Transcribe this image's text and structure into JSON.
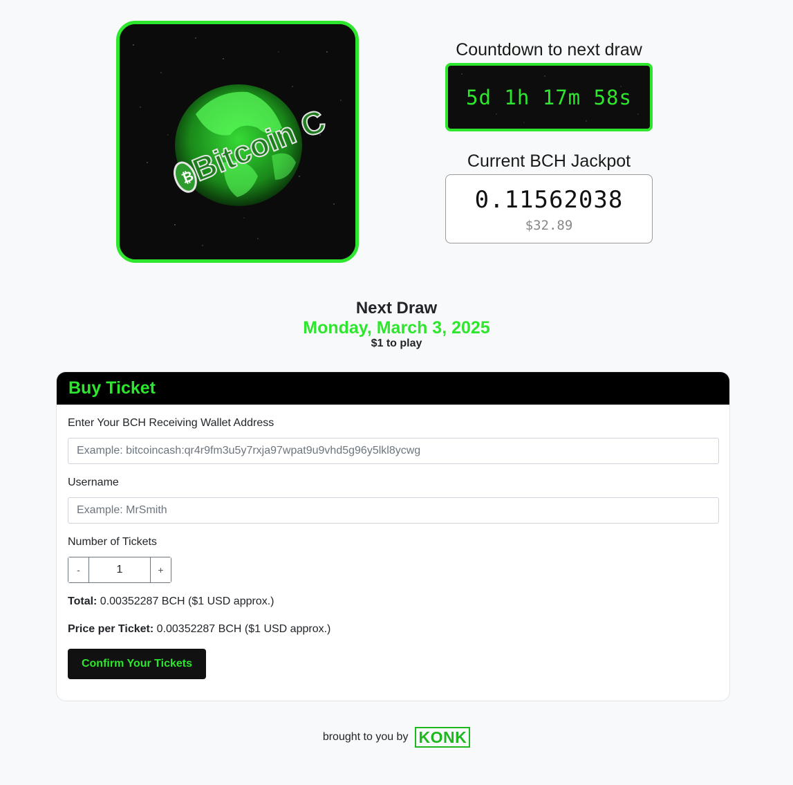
{
  "hero": {
    "logo_text": "Bitcoin C"
  },
  "countdown": {
    "label": "Countdown to next draw",
    "value": "5d 1h 17m 58s"
  },
  "jackpot": {
    "label": "Current BCH Jackpot",
    "bch": "0.11562038",
    "usd": "$32.89"
  },
  "next_draw": {
    "title": "Next Draw",
    "date": "Monday, March 3, 2025",
    "price": "$1 to play"
  },
  "buy_ticket": {
    "title": "Buy Ticket",
    "wallet_label": "Enter Your BCH Receiving Wallet Address",
    "wallet_placeholder": "Example: bitcoincash:qr4r9fm3u5y7rxja97wpat9u9vhd5g96y5lkl8ycwg",
    "username_label": "Username",
    "username_placeholder": "Example: MrSmith",
    "tickets_label": "Number of Tickets",
    "minus_label": "-",
    "plus_label": "+",
    "ticket_count": "1",
    "total_label": "Total:",
    "total_value": " 0.00352287 BCH ($1 USD approx.)",
    "price_label": "Price per Ticket:",
    "price_value": " 0.00352287 BCH ($1 USD approx.)",
    "confirm_label": "Confirm Your Tickets"
  },
  "footer": {
    "text": "brought to you by",
    "brand": "KONK"
  },
  "colors": {
    "accent": "#2ee62e",
    "dark": "#0d0d0d",
    "background": "#f8f9fa"
  }
}
